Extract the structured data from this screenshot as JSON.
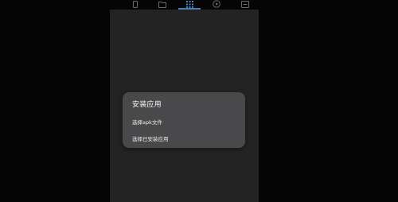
{
  "tabs": [
    {
      "icon": "phone-icon"
    },
    {
      "icon": "folder-icon"
    },
    {
      "icon": "apps-grid-icon",
      "active": true
    },
    {
      "icon": "play-circle-icon"
    },
    {
      "icon": "settings-box-icon"
    }
  ],
  "colors": {
    "background": "#050505",
    "screen": "#232324",
    "dialog": "#49494b",
    "accent": "#4a7eb8"
  },
  "dialog": {
    "title": "安装应用",
    "options": [
      {
        "label": "选择apk文件"
      },
      {
        "label": "选择已安装应用"
      }
    ]
  }
}
